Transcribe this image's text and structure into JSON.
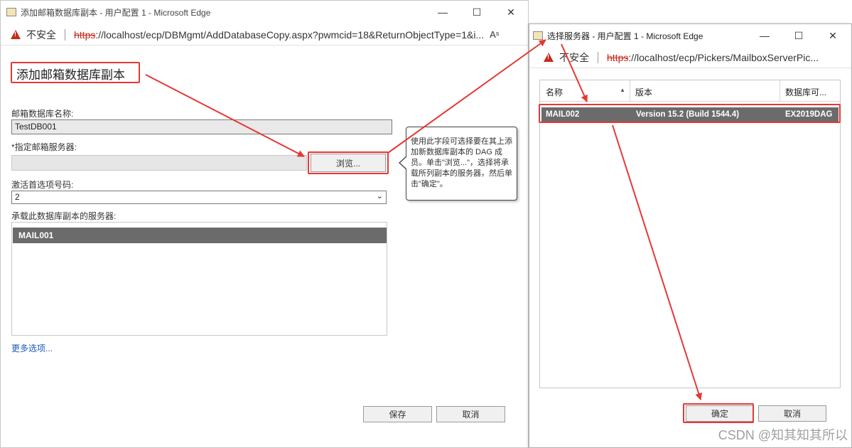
{
  "window1": {
    "title": "添加邮箱数据库副本 - 用户配置 1 - Microsoft Edge",
    "security": "不安全",
    "url_https": "https",
    "url_rest": "://localhost/ecp/DBMgmt/AddDatabaseCopy.aspx?pwmcid=18&ReturnObjectType=1&i...",
    "heading": "添加邮箱数据库副本",
    "db_name_label": "邮箱数据库名称:",
    "db_name_value": "TestDB001",
    "server_label": "*指定邮箱服务器:",
    "browse_label": "浏览...",
    "activation_label": "激活首选项号码:",
    "activation_value": "2",
    "hosting_label": "承载此数据库副本的服务器:",
    "hosting_servers": [
      "MAIL001"
    ],
    "more_options": "更多选项...",
    "save_label": "保存",
    "cancel_label": "取消",
    "tooltip": "使用此字段可选择要在其上添加新数据库副本的 DAG 成员。单击\"浏览...\"，选择将承载所列副本的服务器，然后单击\"确定\"。"
  },
  "window2": {
    "title": "选择服务器 - 用户配置 1 - Microsoft Edge",
    "security": "不安全",
    "url_https": "https",
    "url_rest": "://localhost/ecp/Pickers/MailboxServerPic...",
    "columns": [
      "名称",
      "版本",
      "数据库可..."
    ],
    "rows": [
      {
        "name": "MAIL002",
        "version": "Version 15.2 (Build 1544.4)",
        "dag": "EX2019DAG"
      }
    ],
    "ok_label": "确定",
    "cancel_label": "取消"
  },
  "watermark": "CSDN @知其知其所以",
  "colors": {
    "annotation": "#e53935",
    "selected_row": "#6b6b6b",
    "link": "#1a5bb8",
    "insecure": "#c42b1c"
  }
}
